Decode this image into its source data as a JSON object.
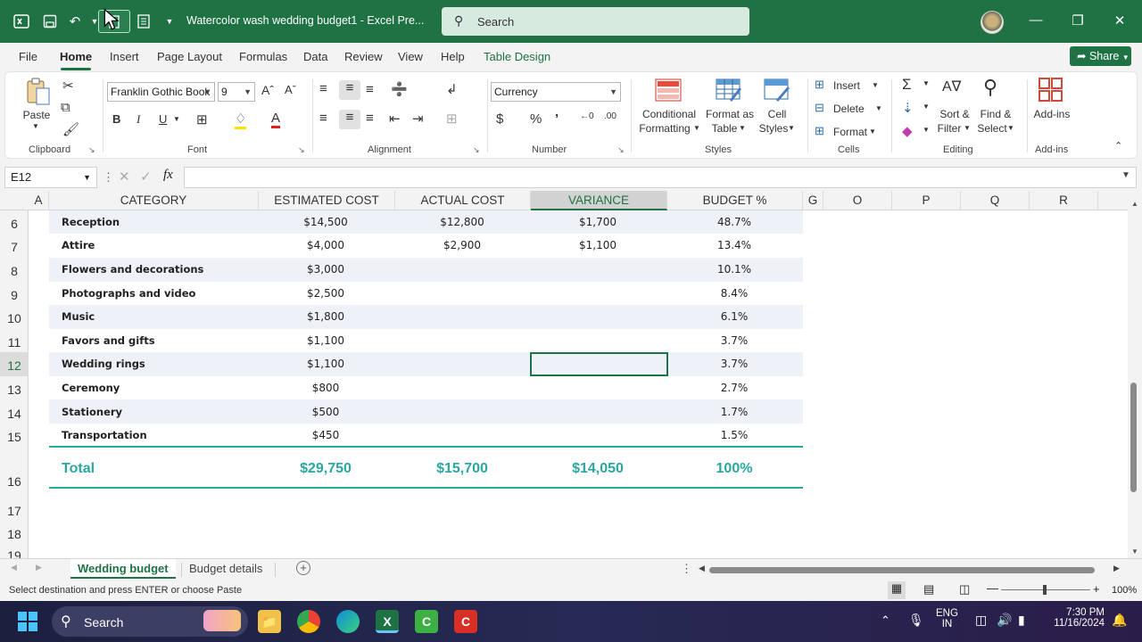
{
  "titlebar": {
    "title": "Watercolor wash wedding budget1  -  Excel Pre...",
    "search_placeholder": "Search"
  },
  "menu": {
    "tabs": [
      "File",
      "Home",
      "Insert",
      "Page Layout",
      "Formulas",
      "Data",
      "Review",
      "View",
      "Help",
      "Table Design"
    ],
    "share": "Share"
  },
  "ribbon": {
    "clipboard": {
      "paste": "Paste",
      "label": "Clipboard"
    },
    "font": {
      "name": "Franklin Gothic Book",
      "size": "9",
      "label": "Font",
      "bold": "B",
      "italic": "I",
      "underline": "U",
      "grow": "Aˆ",
      "shrink": "Aˇ"
    },
    "alignment": {
      "label": "Alignment"
    },
    "number": {
      "format": "Currency",
      "label": "Number",
      "currency": "$",
      "percent": "%",
      "comma": "9"
    },
    "styles": {
      "conditional_1": "Conditional",
      "conditional_2": "Formatting",
      "format_table_1": "Format as",
      "format_table_2": "Table",
      "cell_styles_1": "Cell",
      "cell_styles_2": "Styles",
      "label": "Styles"
    },
    "cells": {
      "insert": "Insert",
      "delete": "Delete",
      "format": "Format",
      "label": "Cells"
    },
    "editing": {
      "sort_1": "Sort &",
      "sort_2": "Filter",
      "find_1": "Find &",
      "find_2": "Select",
      "label": "Editing"
    },
    "addins": {
      "button": "Add-ins",
      "label": "Add-ins"
    }
  },
  "formula_bar": {
    "name_box": "E12",
    "fx": "fx",
    "value": ""
  },
  "sheet": {
    "column_headers": [
      "A",
      "CATEGORY",
      "ESTIMATED COST",
      "ACTUAL COST",
      "VARIANCE",
      "BUDGET %",
      "G",
      "O",
      "P",
      "Q",
      "R"
    ],
    "row_numbers": [
      "6",
      "7",
      "8",
      "9",
      "10",
      "11",
      "12",
      "13",
      "14",
      "15",
      "16",
      "17",
      "18",
      "19"
    ],
    "rows": [
      {
        "category": "Reception",
        "estimated": "$14,500",
        "actual": "$12,800",
        "variance": "$1,700",
        "budget": "48.7%"
      },
      {
        "category": "Attire",
        "estimated": "$4,000",
        "actual": "$2,900",
        "variance": "$1,100",
        "budget": "13.4%"
      },
      {
        "category": "Flowers and decorations",
        "estimated": "$3,000",
        "actual": "",
        "variance": "",
        "budget": "10.1%"
      },
      {
        "category": "Photographs and video",
        "estimated": "$2,500",
        "actual": "",
        "variance": "",
        "budget": "8.4%"
      },
      {
        "category": "Music",
        "estimated": "$1,800",
        "actual": "",
        "variance": "",
        "budget": "6.1%"
      },
      {
        "category": "Favors and gifts",
        "estimated": "$1,100",
        "actual": "",
        "variance": "",
        "budget": "3.7%"
      },
      {
        "category": "Wedding rings",
        "estimated": "$1,100",
        "actual": "",
        "variance": "",
        "budget": "3.7%"
      },
      {
        "category": "Ceremony",
        "estimated": "$800",
        "actual": "",
        "variance": "",
        "budget": "2.7%"
      },
      {
        "category": "Stationery",
        "estimated": "$500",
        "actual": "",
        "variance": "",
        "budget": "1.7%"
      },
      {
        "category": "Transportation",
        "estimated": "$450",
        "actual": "",
        "variance": "",
        "budget": "1.5%"
      }
    ],
    "total": {
      "label": "Total",
      "estimated": "$29,750",
      "actual": "$15,700",
      "variance": "$14,050",
      "budget": "100%"
    },
    "selected_cell": "E12",
    "band_color": "#eef1f8",
    "accent_color": "#2aa7a0"
  },
  "sheet_tabs": [
    "Wedding budget",
    "Budget details"
  ],
  "status": {
    "text": "Select destination and press ENTER or choose Paste",
    "zoom": "100%"
  },
  "taskbar": {
    "search": "Search",
    "lang_1": "ENG",
    "lang_2": "IN",
    "time": "7:30 PM",
    "date": "11/16/2024"
  }
}
